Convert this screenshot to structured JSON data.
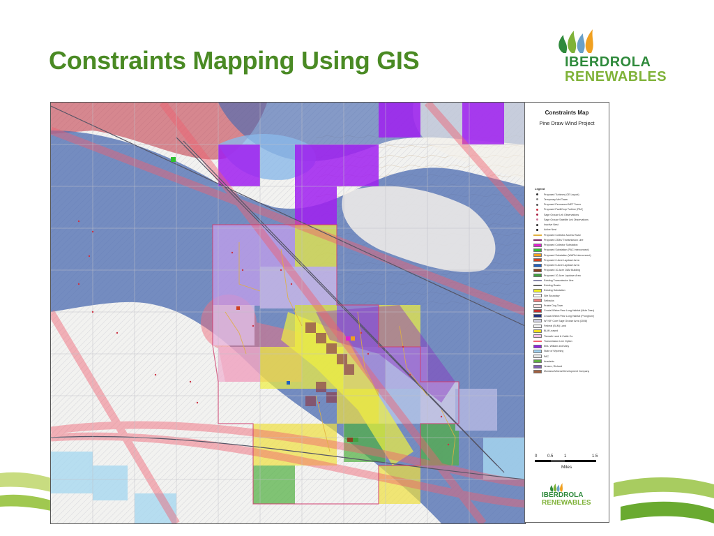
{
  "slide": {
    "title": "Constraints Mapping Using GIS",
    "title_color": "#4a8a24"
  },
  "brand": {
    "name_line1": "IBERDROLA",
    "name_line2": "RENEWABLES",
    "line1_color": "#2f8a3c",
    "line2_color": "#7fb238",
    "logo_icon": "flame-drops-logo-icon"
  },
  "map": {
    "panel_title": "Constraints Map",
    "panel_subtitle": "Pine Draw Wind Project",
    "legend_heading": "Legend",
    "legend_items": [
      {
        "label": "Proposed Turbines (GE Layout)",
        "color": "#333333",
        "type": "dot"
      },
      {
        "label": "Temporary Met Tower",
        "color": "#888888",
        "type": "dot"
      },
      {
        "label": "Proposed Permanent MET Tower",
        "color": "#555555",
        "type": "dot"
      },
      {
        "label": "Proposed PacifiCorp Turbine (PAC)",
        "color": "#cc3344",
        "type": "dot"
      },
      {
        "label": "Sage Grouse Lek Observations",
        "color": "#aa2244",
        "type": "dot"
      },
      {
        "label": "Sage Grouse Satellite Lek Observations",
        "color": "#cc7799",
        "type": "dot"
      },
      {
        "label": "Inactive Nest",
        "color": "#333333",
        "type": "dot"
      },
      {
        "label": "Active Nest",
        "color": "#111111",
        "type": "dot"
      },
      {
        "label": "Proposed Collector Access Road",
        "color": "#e0b040",
        "type": "line"
      },
      {
        "label": "Proposed 230kV Transmission Line",
        "color": "#7a2a6a",
        "type": "line"
      },
      {
        "label": "Proposed Collector Substation",
        "color": "#e020d0",
        "type": "box"
      },
      {
        "label": "Proposed Substation (PAC Interconnect)",
        "color": "#30c030",
        "type": "box"
      },
      {
        "label": "Proposed Substation (WAPA Interconnect)",
        "color": "#f0a020",
        "type": "box"
      },
      {
        "label": "Proposed 2-Acre Laydown Area",
        "color": "#d04020",
        "type": "box"
      },
      {
        "label": "Proposed 5-Acre Laydown Area",
        "color": "#2060c0",
        "type": "box"
      },
      {
        "label": "Proposed 10-Acre O&M Building",
        "color": "#8a4020",
        "type": "box"
      },
      {
        "label": "Proposed 10-Acre Laydown Area",
        "color": "#40a040",
        "type": "box"
      },
      {
        "label": "Existing Transmission Line",
        "color": "#8888aa",
        "type": "line"
      },
      {
        "label": "Existing Roads",
        "color": "#666666",
        "type": "line"
      },
      {
        "label": "Existing Substation",
        "color": "#f0f020",
        "type": "box"
      },
      {
        "label": "Site Boundary",
        "color": "#ffffff",
        "type": "box"
      },
      {
        "label": "Setbacks",
        "color": "#f08080",
        "type": "box"
      },
      {
        "label": "Prairie Dog Town",
        "color": "#f4e0e0",
        "type": "box"
      },
      {
        "label": "Crucial Winter/Year Long Habitat (Mule Deer)",
        "color": "#c03030",
        "type": "box"
      },
      {
        "label": "Crucial Winter/Year Long Habitat (Pronghorn)",
        "color": "#203080",
        "type": "box"
      },
      {
        "label": "WY/SF Core Sage Grouse Area (2008)",
        "color": "#d0d0e0",
        "type": "box"
      },
      {
        "label": "Federal (BLM) Land",
        "color": "#f0f0f0",
        "type": "box"
      },
      {
        "label": "BLM Leased",
        "color": "#f0e020",
        "type": "box"
      },
      {
        "label": "Tiemath Land & Cattle Co.",
        "color": "#f0c0e8",
        "type": "box"
      },
      {
        "label": "Transmission Line Option",
        "color": "#f06070",
        "type": "line"
      },
      {
        "label": "Ellis, William and Mary",
        "color": "#9020e0",
        "type": "box"
      },
      {
        "label": "State of Wyoming",
        "color": "#a0d0f0",
        "type": "box"
      },
      {
        "label": "PAC",
        "color": "#e8e8e8",
        "type": "box"
      },
      {
        "label": "Anadarko",
        "color": "#60b040",
        "type": "box"
      },
      {
        "label": "Jensen, Richard",
        "color": "#8060b0",
        "type": "box"
      },
      {
        "label": "Montana Mineral Development Company",
        "color": "#a06040",
        "type": "box"
      }
    ],
    "scale": {
      "ticks": [
        "0",
        "0.5",
        "1",
        "1.5"
      ],
      "units": "Miles"
    }
  },
  "colors": {
    "blue_habitat": "#4a6ab0",
    "purple_parcel": "#a020f0",
    "pink_setback": "#f07080",
    "red_habitat": "#c03040",
    "yellow_blm": "#f0f040",
    "green_anadarko": "#50b040",
    "light_blue_state": "#a8d8f0"
  }
}
